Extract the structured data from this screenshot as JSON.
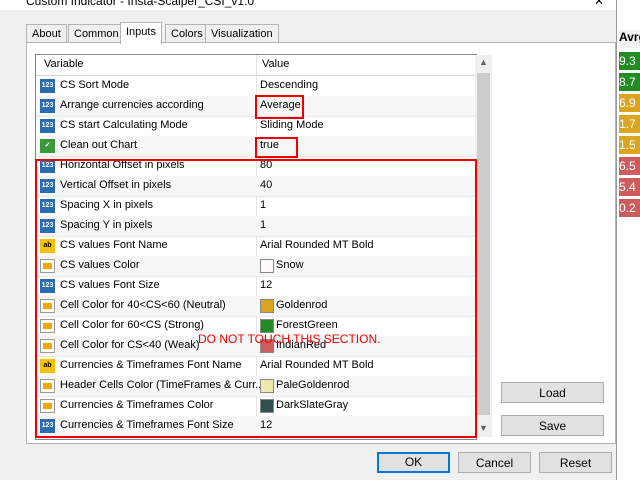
{
  "window": {
    "title": "Custom Indicator - Insta-Scalper_CSI_v1.0",
    "close_glyph": "✕"
  },
  "tabs": [
    {
      "label": "About",
      "active": false
    },
    {
      "label": "Common",
      "active": false
    },
    {
      "label": "Inputs",
      "active": true
    },
    {
      "label": "Colors",
      "active": false
    },
    {
      "label": "Visualization",
      "active": false
    }
  ],
  "grid": {
    "header": {
      "variable": "Variable",
      "value": "Value"
    },
    "rows": [
      {
        "icon": "numeric-icon",
        "name": "CS Sort Mode",
        "value": "Descending"
      },
      {
        "icon": "numeric-icon",
        "name": "Arrange currencies according",
        "value": "Average"
      },
      {
        "icon": "numeric-icon",
        "name": "CS start Calculating Mode",
        "value": "Sliding Mode"
      },
      {
        "icon": "boolean-icon",
        "name": "Clean out Chart",
        "value": "true"
      },
      {
        "icon": "numeric-icon",
        "name": "Horizontal Offset in pixels",
        "value": "80"
      },
      {
        "icon": "numeric-icon",
        "name": "Vertical Offset in pixels",
        "value": "40"
      },
      {
        "icon": "numeric-icon",
        "name": "Spacing X in pixels",
        "value": "1"
      },
      {
        "icon": "numeric-icon",
        "name": "Spacing Y in pixels",
        "value": "1"
      },
      {
        "icon": "string-icon",
        "name": "CS values Font Name",
        "value": "Arial Rounded MT Bold"
      },
      {
        "icon": "color-icon",
        "name": "CS values Color",
        "value": "Snow",
        "swatch": "#fffafa"
      },
      {
        "icon": "numeric-icon",
        "name": "CS values Font Size",
        "value": "12"
      },
      {
        "icon": "color-icon",
        "name": "Cell Color for 40<CS<60 (Neutral)",
        "value": "Goldenrod",
        "swatch": "#daa520"
      },
      {
        "icon": "color-icon",
        "name": "Cell Color for 60<CS     (Strong)",
        "value": "ForestGreen",
        "swatch": "#228b22"
      },
      {
        "icon": "color-icon",
        "name": "Cell Color for     CS<40 (Weak)",
        "value": "IndianRed",
        "swatch": "#cd5c5c"
      },
      {
        "icon": "string-icon",
        "name": "Currencies & Timeframes Font Name",
        "value": "Arial Rounded MT Bold"
      },
      {
        "icon": "color-icon",
        "name": "Header Cells Color (TimeFrames & Curr...",
        "value": "PaleGoldenrod",
        "swatch": "#eee8aa"
      },
      {
        "icon": "color-icon",
        "name": "Currencies & Timeframes Color",
        "value": "DarkSlateGray",
        "swatch": "#2f4f4f"
      },
      {
        "icon": "numeric-icon",
        "name": "Currencies & Timeframes Font Size",
        "value": "12"
      }
    ]
  },
  "annotation": {
    "warning": "DO NOT TOUCH THIS SECTION.",
    "color": "#e00000"
  },
  "side_buttons": {
    "load": "Load",
    "save": "Save"
  },
  "footer_buttons": {
    "ok": "OK",
    "cancel": "Cancel",
    "reset": "Reset"
  },
  "background_table": {
    "header": "Avrg",
    "cells": [
      {
        "text": "9.3",
        "color": "#228b22"
      },
      {
        "text": "8.7",
        "color": "#228b22"
      },
      {
        "text": "6.9",
        "color": "#daa520"
      },
      {
        "text": "1.7",
        "color": "#daa520"
      },
      {
        "text": "1.5",
        "color": "#daa520"
      },
      {
        "text": "6.5",
        "color": "#cd5c5c"
      },
      {
        "text": "5.4",
        "color": "#cd5c5c"
      },
      {
        "text": "0.2",
        "color": "#cd5c5c"
      }
    ]
  }
}
